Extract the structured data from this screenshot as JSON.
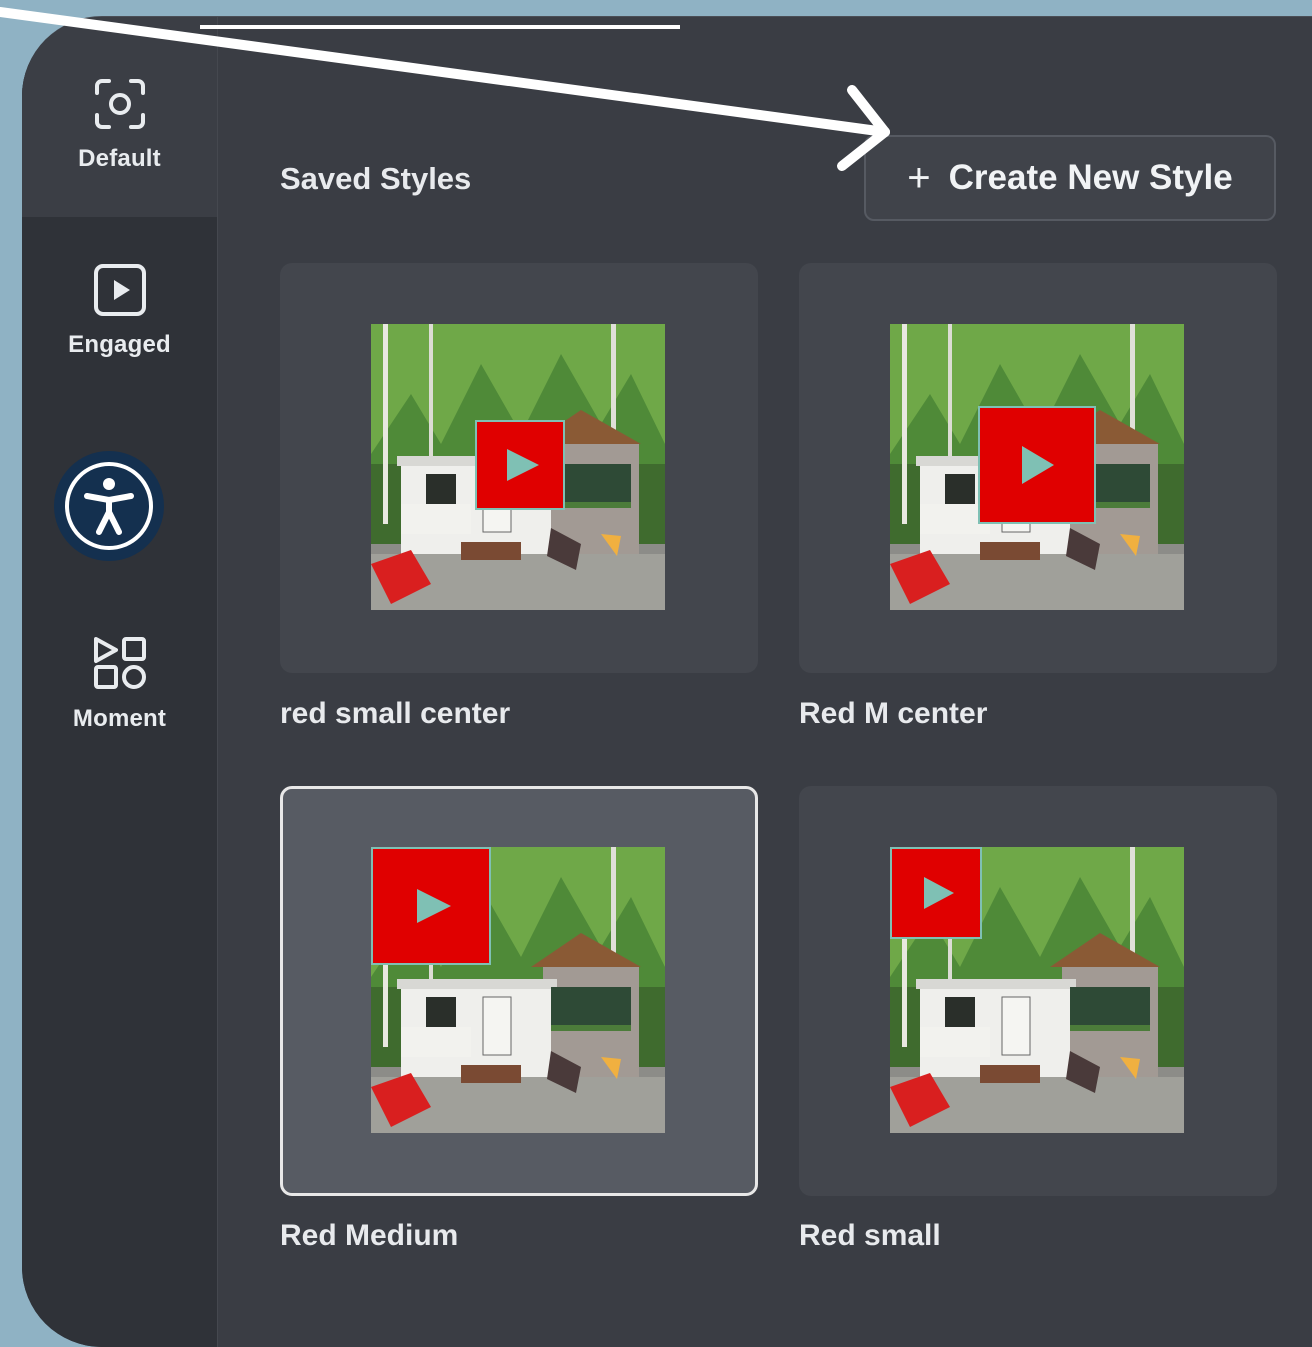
{
  "sidebar": {
    "items": [
      {
        "label": "Default",
        "icon": "focus-frame-icon"
      },
      {
        "label": "Engaged",
        "icon": "play-square-icon"
      },
      {
        "label": "Moment",
        "icon": "shapes-grid-icon"
      }
    ],
    "accessibility_icon": "accessibility-icon"
  },
  "main": {
    "title": "Saved Styles",
    "create_button": {
      "label": "Create New Style",
      "icon": "plus-icon"
    },
    "styles": [
      {
        "label": "red small center",
        "play_size": "small",
        "play_position": "center"
      },
      {
        "label": "Red M center",
        "play_size": "medium",
        "play_position": "center"
      },
      {
        "label": "Red Medium",
        "play_size": "medium",
        "play_position": "top-left",
        "selected": true
      },
      {
        "label": "Red small",
        "play_size": "small",
        "play_position": "top-left"
      }
    ]
  },
  "colors": {
    "background": "#8fb2c4",
    "panel": "#3a3d44",
    "sidebar": "#2f3238",
    "play_button": "#e00000",
    "play_triangle": "#7fc0b4",
    "accessibility": "#14304f"
  }
}
